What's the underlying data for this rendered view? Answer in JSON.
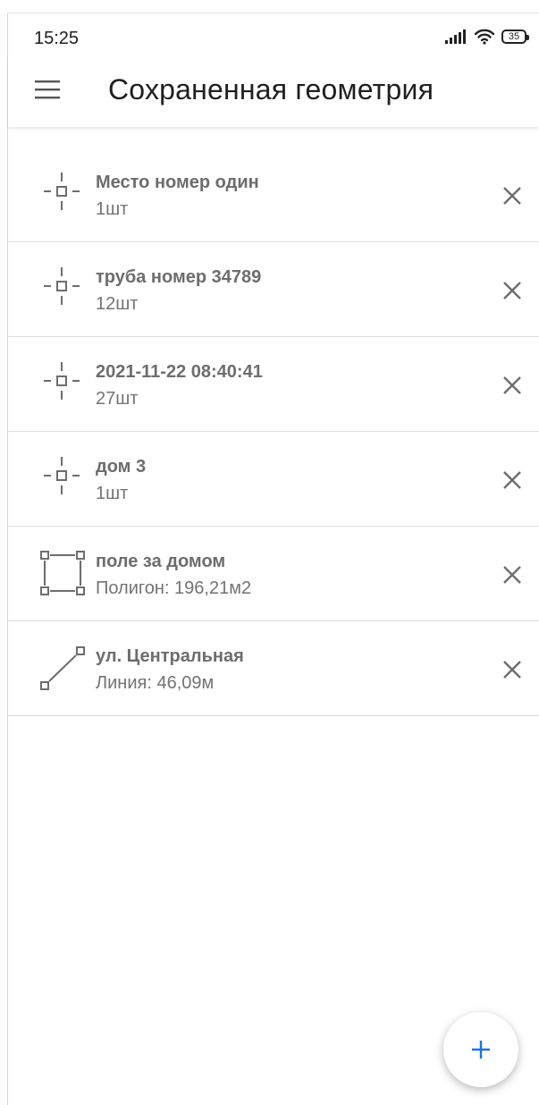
{
  "status_bar": {
    "time": "15:25",
    "battery": "35"
  },
  "app_bar": {
    "title": "Сохраненная геометрия"
  },
  "items": [
    {
      "title": "Место номер один",
      "subtitle": "1шт",
      "icon": "point-icon"
    },
    {
      "title": "труба номер 34789",
      "subtitle": "12шт",
      "icon": "point-icon"
    },
    {
      "title": "2021-11-22 08:40:41",
      "subtitle": "27шт",
      "icon": "point-icon"
    },
    {
      "title": "дом 3",
      "subtitle": "1шт",
      "icon": "point-icon"
    },
    {
      "title": "поле за домом",
      "subtitle": "Полигон: 196,21м2",
      "icon": "polygon-icon"
    },
    {
      "title": "ул. Центральная",
      "subtitle": "Линия: 46,09м",
      "icon": "line-icon"
    }
  ],
  "colors": {
    "accent": "#1a73e8",
    "icon": "#6d6d6d",
    "text_primary": "#1f1f1f"
  }
}
